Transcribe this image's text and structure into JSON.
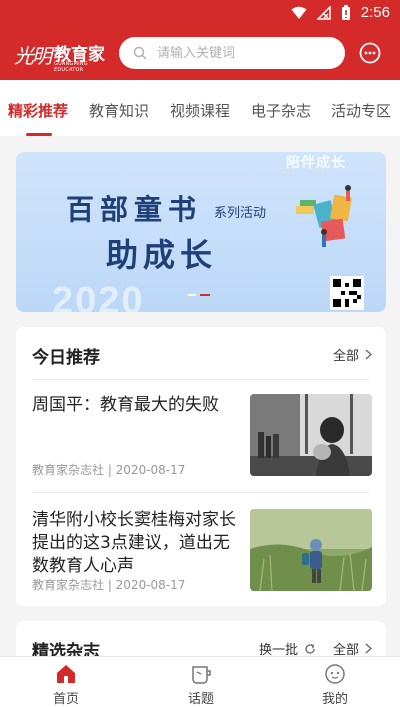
{
  "status": {
    "time": "2:56"
  },
  "header": {
    "logo_script": "光明",
    "logo_title": "教育家",
    "logo_subtitle": "GUANGMING EDUCATOR",
    "search_placeholder": "请输入关键词"
  },
  "tabs": [
    {
      "label": "精彩推荐",
      "active": true
    },
    {
      "label": "教育知识",
      "active": false
    },
    {
      "label": "视频课程",
      "active": false
    },
    {
      "label": "电子杂志",
      "active": false
    },
    {
      "label": "活动专区",
      "active": false
    }
  ],
  "banner": {
    "tag": "陪伴成长",
    "line1": "百部童书",
    "subtitle": "系列活动",
    "line2": "助成长",
    "year": "2020"
  },
  "today": {
    "title": "今日推荐",
    "more_label": "全部",
    "articles": [
      {
        "title": "周国平：教育最大的失败",
        "meta": "教育家杂志社 | 2020-08-17"
      },
      {
        "title": "清华附小校长窦桂梅对家长提出的这3点建议，道出无数教育人心声",
        "meta": "教育家杂志社 | 2020-08-17"
      }
    ]
  },
  "magazines": {
    "title": "精选杂志",
    "refresh_label": "换一批",
    "more_label": "全部"
  },
  "bottom_nav": [
    {
      "label": "首页",
      "active": true
    },
    {
      "label": "话题",
      "active": false
    },
    {
      "label": "我的",
      "active": false
    }
  ],
  "colors": {
    "brand_red": "#d42a2a",
    "banner_text": "#1f3f78"
  }
}
